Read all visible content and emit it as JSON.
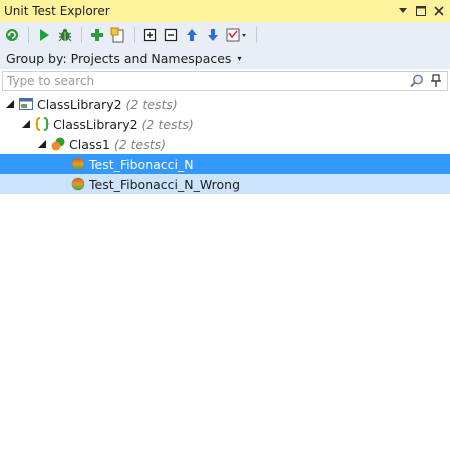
{
  "window": {
    "title": "Unit Test Explorer",
    "controls": [
      "dropdown-arrow",
      "maximize",
      "close"
    ]
  },
  "toolbar": {
    "buttons": [
      "refresh-icon",
      "run-icon",
      "debug-bug-icon",
      "add-icon",
      "add-item-icon",
      "expand-all-icon",
      "collapse-all-icon",
      "arrow-up-icon",
      "arrow-down-icon",
      "options-icon"
    ]
  },
  "group": {
    "label": "Group by: Projects and Namespaces",
    "arrow": "▾"
  },
  "search": {
    "placeholder": "Type to search",
    "value": ""
  },
  "tree": {
    "items": [
      {
        "label": "ClassLibrary2",
        "count": "(2 tests)",
        "icon": "project-icon",
        "level": 0
      },
      {
        "label": "ClassLibrary2",
        "count": "(2 tests)",
        "icon": "namespace-icon",
        "level": 1
      },
      {
        "label": "Class1",
        "count": "(2 tests)",
        "icon": "class-icon",
        "level": 2
      },
      {
        "label": "Test_Fibonacci_N",
        "count": "",
        "icon": "test-icon",
        "level": 3,
        "state": "selected"
      },
      {
        "label": "Test_Fibonacci_N_Wrong",
        "count": "",
        "icon": "test-icon",
        "level": 3,
        "state": "highlighted"
      }
    ]
  },
  "colors": {
    "title_bg": "#fff29d",
    "toolbar_bg": "#e9edf5",
    "selected_bg": "#3399ff",
    "highlight_bg": "#cce4fb"
  }
}
